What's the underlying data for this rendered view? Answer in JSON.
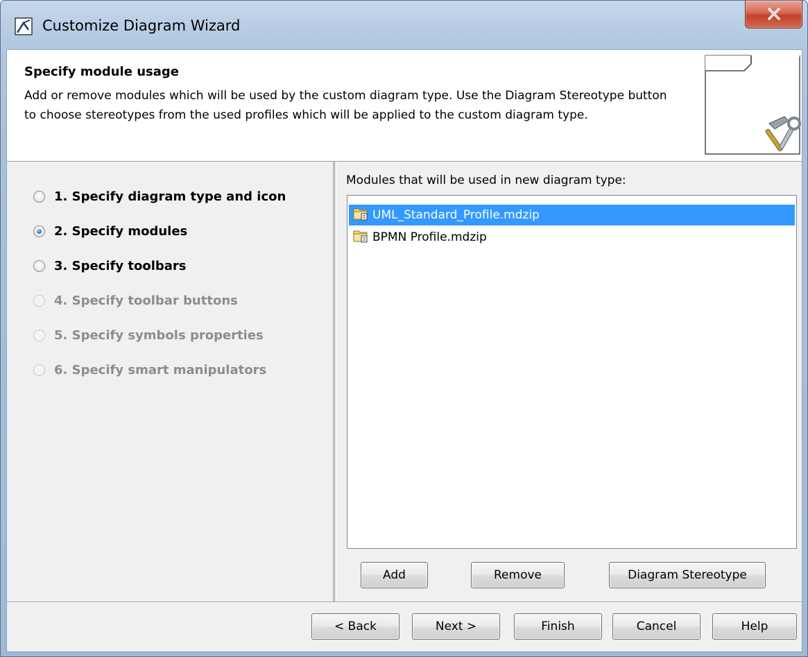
{
  "window": {
    "title": "Customize Diagram Wizard",
    "icons": {
      "app": "diagram-wizard-icon",
      "close": "close-icon"
    }
  },
  "header": {
    "title": "Specify module usage",
    "description": "Add or remove modules which will be used by the custom diagram type. Use the Diagram Stereotype button to choose stereotypes from the used profiles which will be applied to the custom diagram type.",
    "icon": "page-with-tools-icon"
  },
  "steps": [
    {
      "label": "1. Specify diagram type and icon",
      "selected": false,
      "enabled": true
    },
    {
      "label": "2. Specify modules",
      "selected": true,
      "enabled": true
    },
    {
      "label": "3. Specify toolbars",
      "selected": false,
      "enabled": true
    },
    {
      "label": "4. Specify toolbar buttons",
      "selected": false,
      "enabled": false
    },
    {
      "label": "5. Specify symbols properties",
      "selected": false,
      "enabled": false
    },
    {
      "label": "6. Specify smart manipulators",
      "selected": false,
      "enabled": false
    }
  ],
  "modules": {
    "label": "Modules that will be used in new diagram type:",
    "items": [
      {
        "name": "UML_Standard_Profile.mdzip",
        "selected": true,
        "icon": "module-folder-icon"
      },
      {
        "name": "BPMN Profile.mdzip",
        "selected": false,
        "icon": "module-folder-icon"
      }
    ],
    "buttons": {
      "add": "Add",
      "remove": "Remove",
      "stereotype": "Diagram Stereotype"
    }
  },
  "footer": {
    "back": "< Back",
    "next": "Next >",
    "finish": "Finish",
    "cancel": "Cancel",
    "help": "Help"
  },
  "colors": {
    "selection": "#3399ff",
    "close_button": "#c94a32",
    "disabled_text": "#8c8c8c"
  }
}
